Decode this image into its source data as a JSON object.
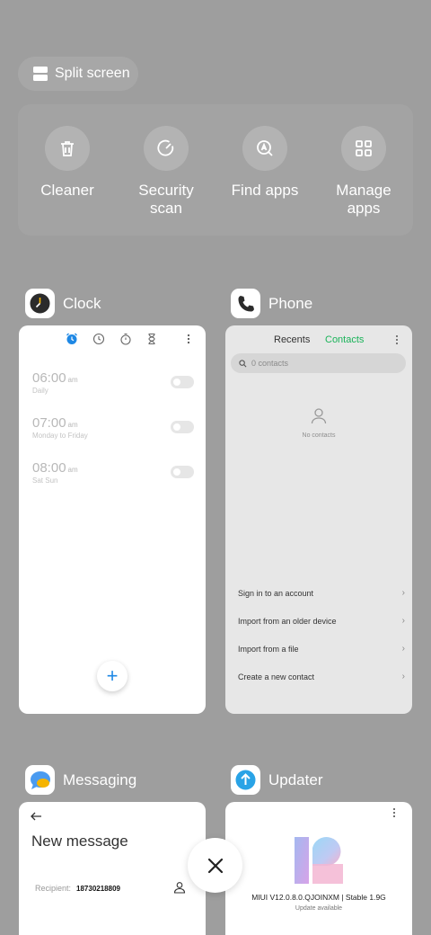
{
  "split_screen": {
    "label": "Split screen"
  },
  "tools": [
    {
      "line1": "Cleaner",
      "line2": "",
      "icon": "trash-icon"
    },
    {
      "line1": "Security",
      "line2": "scan",
      "icon": "security-scan-icon"
    },
    {
      "line1": "Find apps",
      "line2": "",
      "icon": "find-apps-icon"
    },
    {
      "line1": "Manage",
      "line2": "apps",
      "icon": "manage-apps-icon"
    }
  ],
  "apps": {
    "clock": {
      "name": "Clock",
      "alarms": [
        {
          "time": "06:00",
          "ampm": "am",
          "repeat": "Daily"
        },
        {
          "time": "07:00",
          "ampm": "am",
          "repeat": "Monday to Friday"
        },
        {
          "time": "08:00",
          "ampm": "am",
          "repeat": "Sat Sun"
        }
      ],
      "fab": "+"
    },
    "phone": {
      "name": "Phone",
      "tab_recents": "Recents",
      "tab_contacts": "Contacts",
      "search_placeholder": "0 contacts",
      "empty_label": "No contacts",
      "rows": [
        "Sign in to an account",
        "Import from an older device",
        "Import from a file",
        "Create a new contact"
      ]
    },
    "messaging": {
      "name": "Messaging",
      "title": "New message",
      "recipient_label": "Recipient:",
      "recipient_value": "18730218809"
    },
    "updater": {
      "name": "Updater",
      "version": "MIUI V12.0.8.0.QJOINXM | Stable 1.9G",
      "status": "Update available"
    }
  },
  "colors": {
    "background": "#9e9e9e",
    "accent_green": "#1bb35a",
    "accent_blue": "#1e88e5"
  }
}
